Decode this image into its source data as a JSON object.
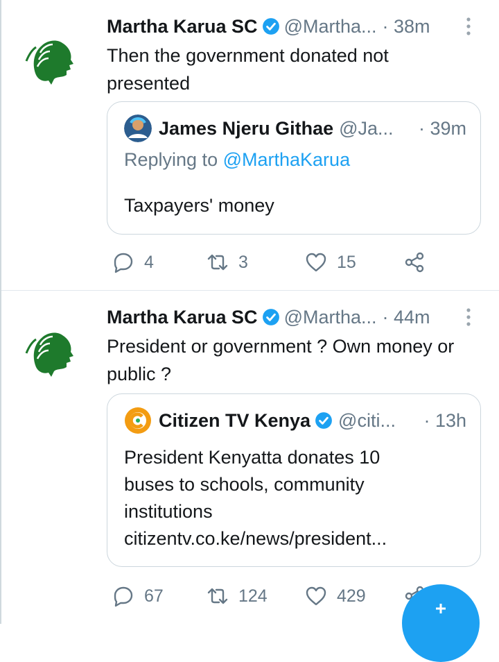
{
  "tweets": [
    {
      "author_name": "Martha Karua SC",
      "handle": "@Martha...",
      "time": "· 38m",
      "text": "Then the government donated not presented",
      "quote": {
        "author_name": "James Njeru Githae",
        "handle": "@Ja...",
        "time": "· 39m",
        "replying_prefix": "Replying to ",
        "replying_mention": "@MarthaKarua",
        "text": "Taxpayers' money"
      },
      "counts": {
        "replies": "4",
        "retweets": "3",
        "likes": "15"
      }
    },
    {
      "author_name": "Martha Karua SC",
      "handle": "@Martha...",
      "time": "· 44m",
      "text": "President or government ? Own money or public ?",
      "quote": {
        "author_name": "Citizen TV Kenya",
        "handle": "@citi...",
        "time": "· 13h",
        "text_line1": "President Kenyatta donates 10",
        "text_line2": "buses to schools, community",
        "text_line3": "institutions",
        "link": "citizentv.co.ke/news/president..."
      },
      "counts": {
        "replies": "67",
        "retweets": "124",
        "likes": "429"
      }
    }
  ],
  "icons": {
    "verified": "verified-badge-icon",
    "more": "more-vertical-icon",
    "reply": "reply-icon",
    "retweet": "retweet-icon",
    "like": "heart-icon",
    "share": "share-icon",
    "compose": "compose-plus-icon"
  },
  "colors": {
    "accent": "#1da1f2",
    "secondary_text": "#657786",
    "avatar_green": "#1e7a2c",
    "citizen_orange": "#f39c12"
  }
}
